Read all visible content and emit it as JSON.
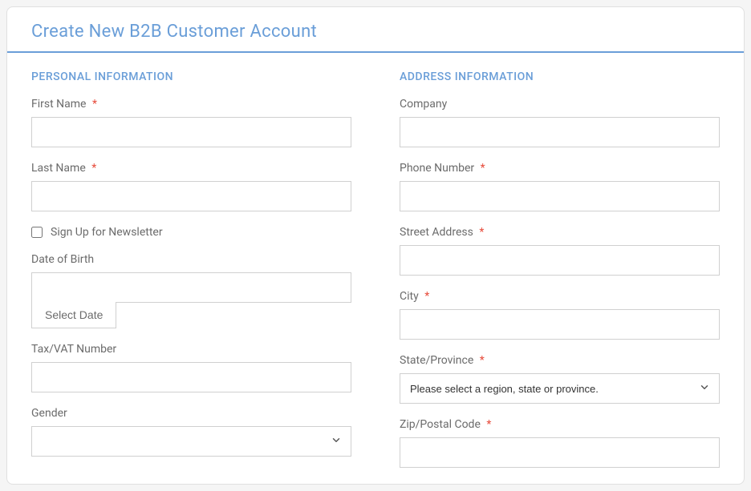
{
  "header": {
    "title": "Create New B2B Customer Account"
  },
  "personal": {
    "section_title": "PERSONAL INFORMATION",
    "first_name_label": "First Name",
    "last_name_label": "Last Name",
    "newsletter_label": "Sign Up for Newsletter",
    "dob_label": "Date of Birth",
    "select_date_btn": "Select Date",
    "tax_label": "Tax/VAT Number",
    "gender_label": "Gender"
  },
  "address": {
    "section_title": "ADDRESS INFORMATION",
    "company_label": "Company",
    "phone_label": "Phone Number",
    "street_label": "Street Address",
    "city_label": "City",
    "state_label": "State/Province",
    "state_placeholder": "Please select a region, state or province.",
    "zip_label": "Zip/Postal Code"
  },
  "required_marker": "*"
}
